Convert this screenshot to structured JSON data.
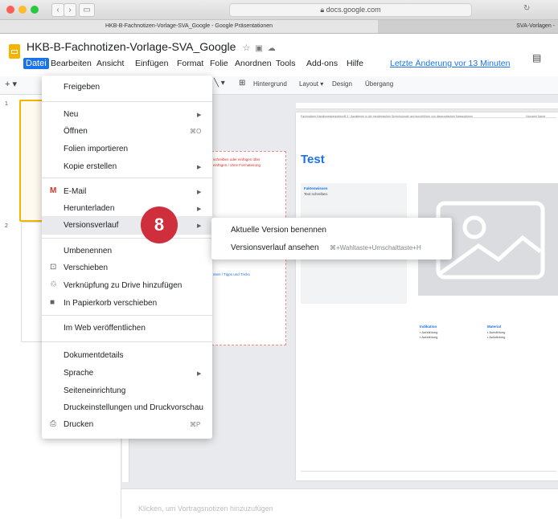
{
  "browser": {
    "url": "docs.google.com",
    "tabs": [
      "HKB-B-Fachnotizen-Vorlage-SVA_Google - Google Präsentationen",
      "SVA-Vorlagen -"
    ]
  },
  "doc": {
    "title": "HKB-B-Fachnotizen-Vorlage-SVA_Google",
    "last_change": "Letzte Änderung vor 13 Minuten"
  },
  "menubar": [
    "Datei",
    "Bearbeiten",
    "Ansicht",
    "Einfügen",
    "Format",
    "Folie",
    "Anordnen",
    "Tools",
    "Add-ons",
    "Hilfe"
  ],
  "toolbar": {
    "background": "Hintergrund",
    "layout": "Layout ▾",
    "design": "Design",
    "transition": "Übergang"
  },
  "filmstrip": {
    "slide_numbers": [
      "1",
      "2"
    ]
  },
  "file_menu": {
    "share": "Freigeben",
    "new": "Neu",
    "open": "Öffnen",
    "open_shortcut": "⌘O",
    "import": "Folien importieren",
    "copy": "Kopie erstellen",
    "email": "E-Mail",
    "download": "Herunterladen",
    "version_history": "Versionsverlauf",
    "rename": "Umbenennen",
    "move": "Verschieben",
    "shortcut": "Verknüpfung zu Drive hinzufügen",
    "trash": "In Papierkorb verschieben",
    "publish": "Im Web veröffentlichen",
    "details": "Dokumentdetails",
    "language": "Sprache",
    "page_setup": "Seiteneinrichtung",
    "print_settings": "Druckeinstellungen und Druckvorschau",
    "print": "Drucken",
    "print_shortcut": "⌘P"
  },
  "submenu": {
    "name_version": "Aktuelle Version benennen",
    "see_history": "Versionsverlauf ansehen",
    "see_history_shortcut": "⌘+Wahltaste+Umschalttaste+H"
  },
  "step_badge": "8",
  "slide": {
    "header_text": "Fachnotizen HandlungskompetenzB.3 · Assistieren in der medizinischen Sprechstunde und durchführen von diagnostischen Massnahmen",
    "author": "Vorname Name",
    "title": "Test",
    "facts_label": "Faktenwissen",
    "facts_text": "Text schreiben.",
    "indication_label": "Indikation",
    "material_label": "Material",
    "bullet": "Aufzählung"
  },
  "background_slide_text": {
    "line1": "schreiben oder einfügen über",
    "line2": "einfügen / ohne Formatierung",
    "tips": "ssen / Tipps und Tricks"
  },
  "notes_placeholder": "Klicken, um Vortragsnotizen hinzuzufügen",
  "colors": {
    "accent": "#1a73e8",
    "badge": "#cf2e3c",
    "slides_logo": "#f4b400",
    "slide_title": "#1a73e8"
  }
}
